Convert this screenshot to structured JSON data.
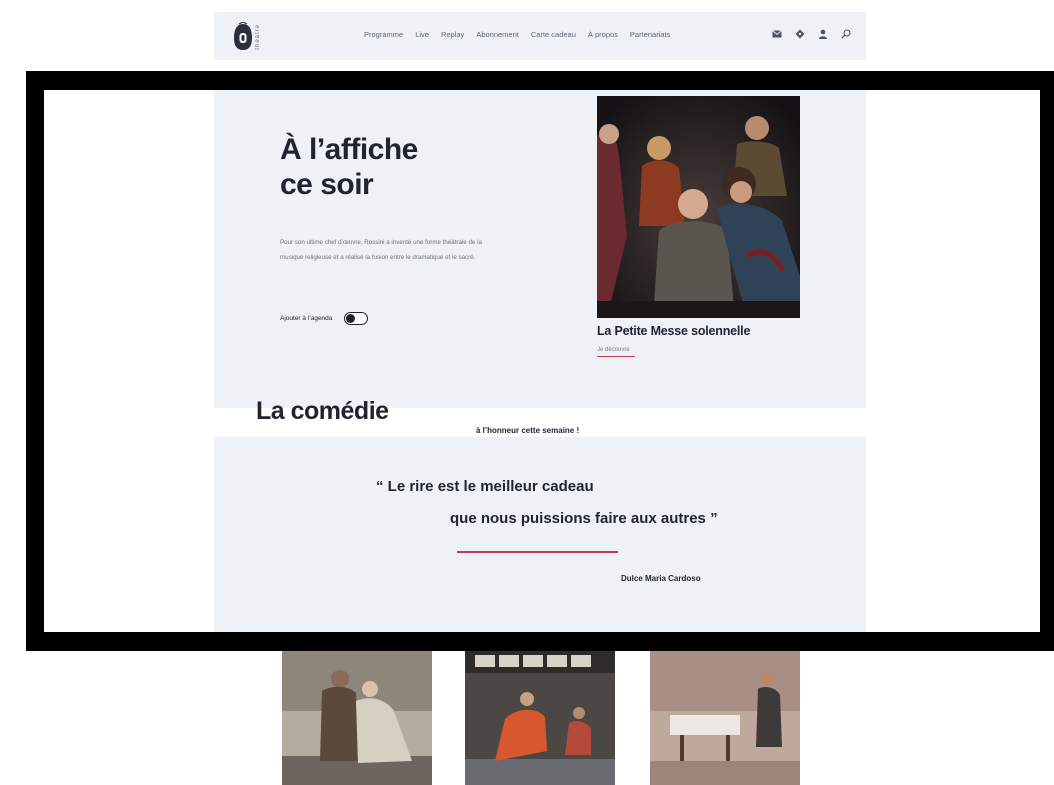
{
  "nav": {
    "logo_text": "théâtre",
    "items": [
      "Programme",
      "Live",
      "Replay",
      "Abonnement",
      "Carte cadeau",
      "À propos",
      "Partenariats"
    ],
    "icons": [
      "mail-icon",
      "ticket-icon",
      "user-icon",
      "search-icon"
    ]
  },
  "hero": {
    "title_line1": "À l’affiche",
    "title_line2": "ce soir",
    "description": "Pour son ultime chef d’œuvre, Rossini a inventé une forme théâtrale de la musique religieuse et a réalisé la fusion entre le dramatique et le sacré.",
    "agenda_label": "Ajouter à l’agenda",
    "agenda_toggle_on": false,
    "show_title": "La Petite Messe solennelle",
    "discover_label": "Je découvre"
  },
  "comedy": {
    "title": "La comédie",
    "subtitle": "à l’honneur cette semaine !",
    "quote_line1": "“ Le rire est le meilleur cadeau",
    "quote_line2": "que nous puissions faire aux autres ”",
    "author": "Dulce Maria Cardoso"
  },
  "colors": {
    "accent": "#c43b50",
    "band": "#eef1f5",
    "text": "#1f2430"
  }
}
